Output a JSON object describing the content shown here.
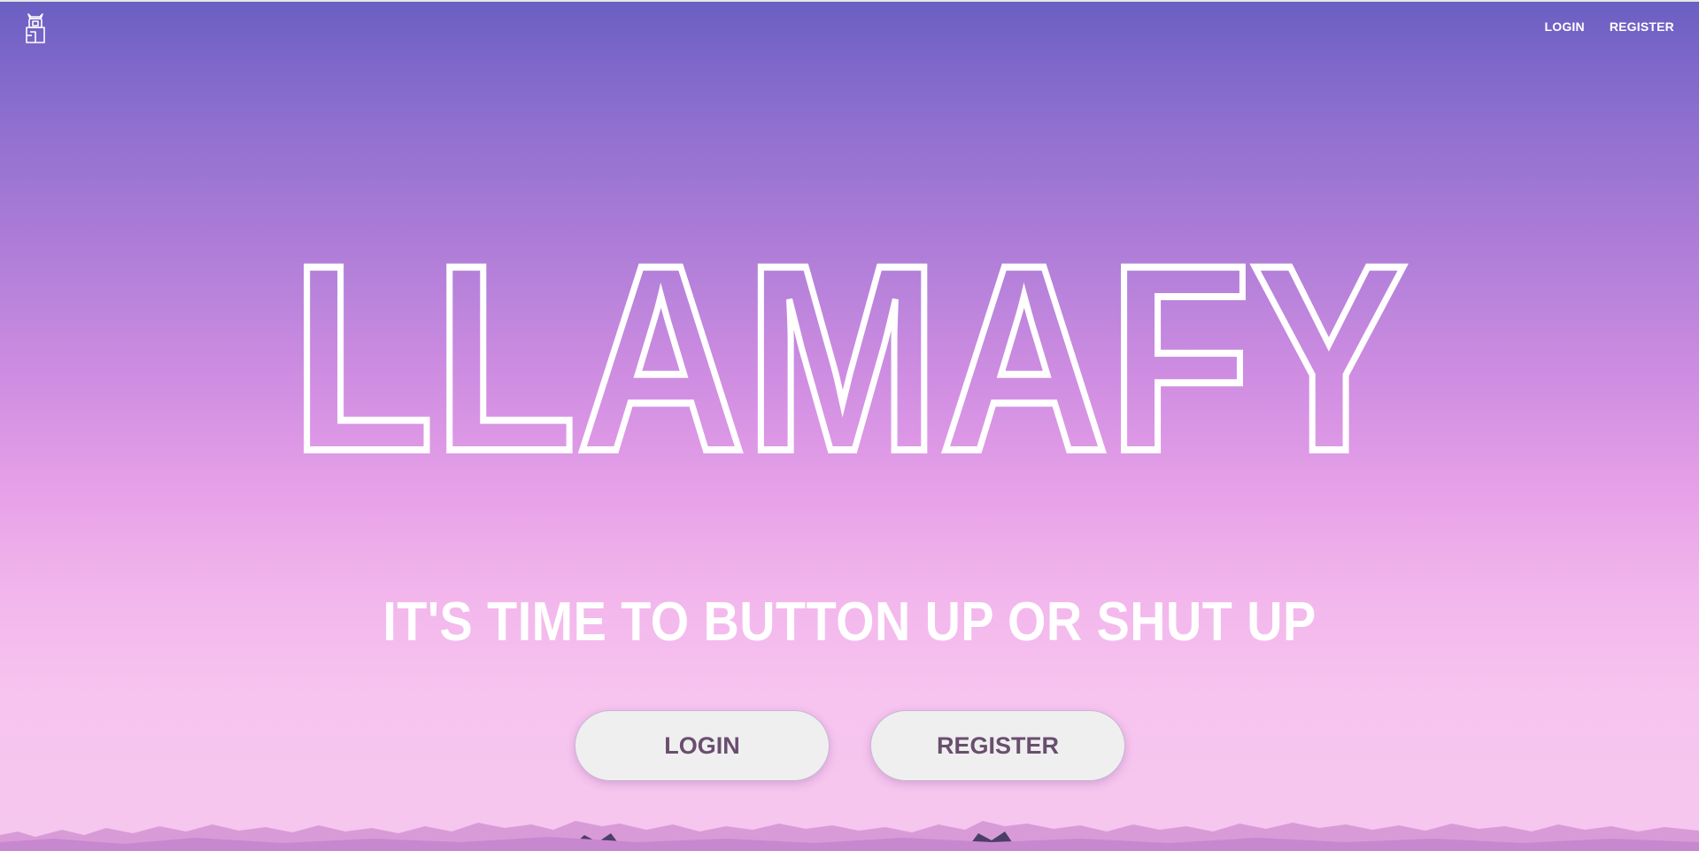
{
  "header": {
    "logo_icon": "llama-logo-icon",
    "nav": {
      "login_label": "LOGIN",
      "register_label": "REGISTER"
    }
  },
  "hero": {
    "brand_title": "LLAMAFY",
    "tagline": "IT'S TIME TO BUTTON UP OR SHUT UP",
    "buttons": {
      "login_label": "LOGIN",
      "register_label": "REGISTER"
    }
  },
  "colors": {
    "gradient_top": "#6a5fc2",
    "gradient_mid": "#d08ee2",
    "gradient_bottom": "#f5c7ee",
    "button_bg": "#efeff0",
    "button_text": "#6a4e6e",
    "text": "#ffffff"
  }
}
